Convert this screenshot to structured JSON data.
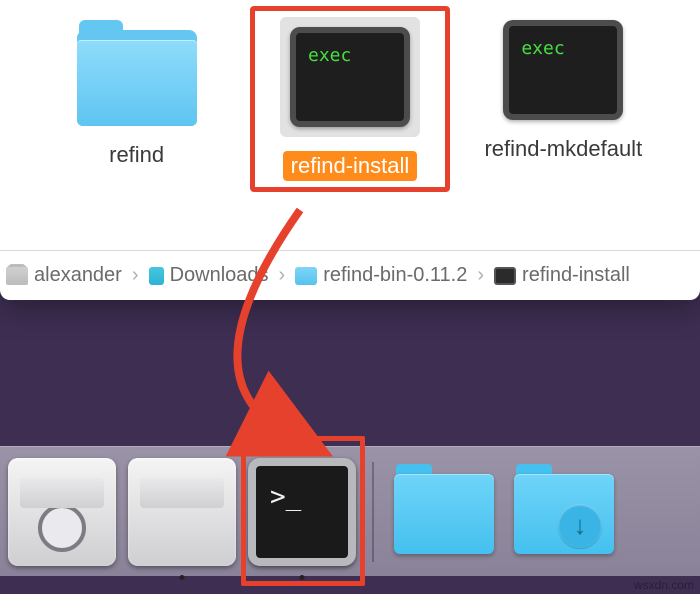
{
  "finder": {
    "items": [
      {
        "label": "refind",
        "type": "folder"
      },
      {
        "label": "refind-install",
        "type": "exec",
        "exec_text": "exec",
        "selected": true
      },
      {
        "label": "refind-mkdefault",
        "type": "exec",
        "exec_text": "exec"
      }
    ],
    "path": [
      {
        "label": "alexander",
        "icon": "home"
      },
      {
        "label": "Downloads",
        "icon": "folder-teal"
      },
      {
        "label": "refind-bin-0.11.2",
        "icon": "folder-blue"
      },
      {
        "label": "refind-install",
        "icon": "exec"
      }
    ]
  },
  "dock": {
    "items": [
      {
        "name": "disk-utility",
        "running": false
      },
      {
        "name": "boot-camp",
        "running": true
      },
      {
        "name": "terminal",
        "running": true,
        "prompt": ">_"
      },
      {
        "name": "divider"
      },
      {
        "name": "folder-generic"
      },
      {
        "name": "folder-downloads",
        "badge": "↓"
      }
    ]
  },
  "watermark": "wsxdn.com"
}
